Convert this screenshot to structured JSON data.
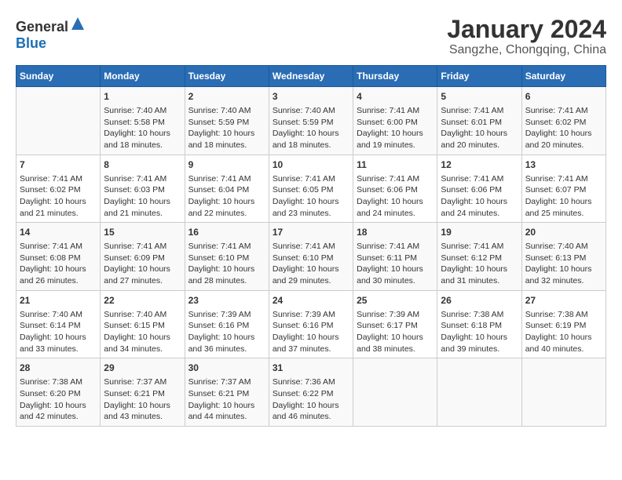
{
  "header": {
    "logo_general": "General",
    "logo_blue": "Blue",
    "title": "January 2024",
    "subtitle": "Sangzhe, Chongqing, China"
  },
  "columns": [
    "Sunday",
    "Monday",
    "Tuesday",
    "Wednesday",
    "Thursday",
    "Friday",
    "Saturday"
  ],
  "weeks": [
    [
      {
        "day": "",
        "content": ""
      },
      {
        "day": "1",
        "content": "Sunrise: 7:40 AM\nSunset: 5:58 PM\nDaylight: 10 hours\nand 18 minutes."
      },
      {
        "day": "2",
        "content": "Sunrise: 7:40 AM\nSunset: 5:59 PM\nDaylight: 10 hours\nand 18 minutes."
      },
      {
        "day": "3",
        "content": "Sunrise: 7:40 AM\nSunset: 5:59 PM\nDaylight: 10 hours\nand 18 minutes."
      },
      {
        "day": "4",
        "content": "Sunrise: 7:41 AM\nSunset: 6:00 PM\nDaylight: 10 hours\nand 19 minutes."
      },
      {
        "day": "5",
        "content": "Sunrise: 7:41 AM\nSunset: 6:01 PM\nDaylight: 10 hours\nand 20 minutes."
      },
      {
        "day": "6",
        "content": "Sunrise: 7:41 AM\nSunset: 6:02 PM\nDaylight: 10 hours\nand 20 minutes."
      }
    ],
    [
      {
        "day": "7",
        "content": "Sunrise: 7:41 AM\nSunset: 6:02 PM\nDaylight: 10 hours\nand 21 minutes."
      },
      {
        "day": "8",
        "content": "Sunrise: 7:41 AM\nSunset: 6:03 PM\nDaylight: 10 hours\nand 21 minutes."
      },
      {
        "day": "9",
        "content": "Sunrise: 7:41 AM\nSunset: 6:04 PM\nDaylight: 10 hours\nand 22 minutes."
      },
      {
        "day": "10",
        "content": "Sunrise: 7:41 AM\nSunset: 6:05 PM\nDaylight: 10 hours\nand 23 minutes."
      },
      {
        "day": "11",
        "content": "Sunrise: 7:41 AM\nSunset: 6:06 PM\nDaylight: 10 hours\nand 24 minutes."
      },
      {
        "day": "12",
        "content": "Sunrise: 7:41 AM\nSunset: 6:06 PM\nDaylight: 10 hours\nand 24 minutes."
      },
      {
        "day": "13",
        "content": "Sunrise: 7:41 AM\nSunset: 6:07 PM\nDaylight: 10 hours\nand 25 minutes."
      }
    ],
    [
      {
        "day": "14",
        "content": "Sunrise: 7:41 AM\nSunset: 6:08 PM\nDaylight: 10 hours\nand 26 minutes."
      },
      {
        "day": "15",
        "content": "Sunrise: 7:41 AM\nSunset: 6:09 PM\nDaylight: 10 hours\nand 27 minutes."
      },
      {
        "day": "16",
        "content": "Sunrise: 7:41 AM\nSunset: 6:10 PM\nDaylight: 10 hours\nand 28 minutes."
      },
      {
        "day": "17",
        "content": "Sunrise: 7:41 AM\nSunset: 6:10 PM\nDaylight: 10 hours\nand 29 minutes."
      },
      {
        "day": "18",
        "content": "Sunrise: 7:41 AM\nSunset: 6:11 PM\nDaylight: 10 hours\nand 30 minutes."
      },
      {
        "day": "19",
        "content": "Sunrise: 7:41 AM\nSunset: 6:12 PM\nDaylight: 10 hours\nand 31 minutes."
      },
      {
        "day": "20",
        "content": "Sunrise: 7:40 AM\nSunset: 6:13 PM\nDaylight: 10 hours\nand 32 minutes."
      }
    ],
    [
      {
        "day": "21",
        "content": "Sunrise: 7:40 AM\nSunset: 6:14 PM\nDaylight: 10 hours\nand 33 minutes."
      },
      {
        "day": "22",
        "content": "Sunrise: 7:40 AM\nSunset: 6:15 PM\nDaylight: 10 hours\nand 34 minutes."
      },
      {
        "day": "23",
        "content": "Sunrise: 7:39 AM\nSunset: 6:16 PM\nDaylight: 10 hours\nand 36 minutes."
      },
      {
        "day": "24",
        "content": "Sunrise: 7:39 AM\nSunset: 6:16 PM\nDaylight: 10 hours\nand 37 minutes."
      },
      {
        "day": "25",
        "content": "Sunrise: 7:39 AM\nSunset: 6:17 PM\nDaylight: 10 hours\nand 38 minutes."
      },
      {
        "day": "26",
        "content": "Sunrise: 7:38 AM\nSunset: 6:18 PM\nDaylight: 10 hours\nand 39 minutes."
      },
      {
        "day": "27",
        "content": "Sunrise: 7:38 AM\nSunset: 6:19 PM\nDaylight: 10 hours\nand 40 minutes."
      }
    ],
    [
      {
        "day": "28",
        "content": "Sunrise: 7:38 AM\nSunset: 6:20 PM\nDaylight: 10 hours\nand 42 minutes."
      },
      {
        "day": "29",
        "content": "Sunrise: 7:37 AM\nSunset: 6:21 PM\nDaylight: 10 hours\nand 43 minutes."
      },
      {
        "day": "30",
        "content": "Sunrise: 7:37 AM\nSunset: 6:21 PM\nDaylight: 10 hours\nand 44 minutes."
      },
      {
        "day": "31",
        "content": "Sunrise: 7:36 AM\nSunset: 6:22 PM\nDaylight: 10 hours\nand 46 minutes."
      },
      {
        "day": "",
        "content": ""
      },
      {
        "day": "",
        "content": ""
      },
      {
        "day": "",
        "content": ""
      }
    ]
  ]
}
